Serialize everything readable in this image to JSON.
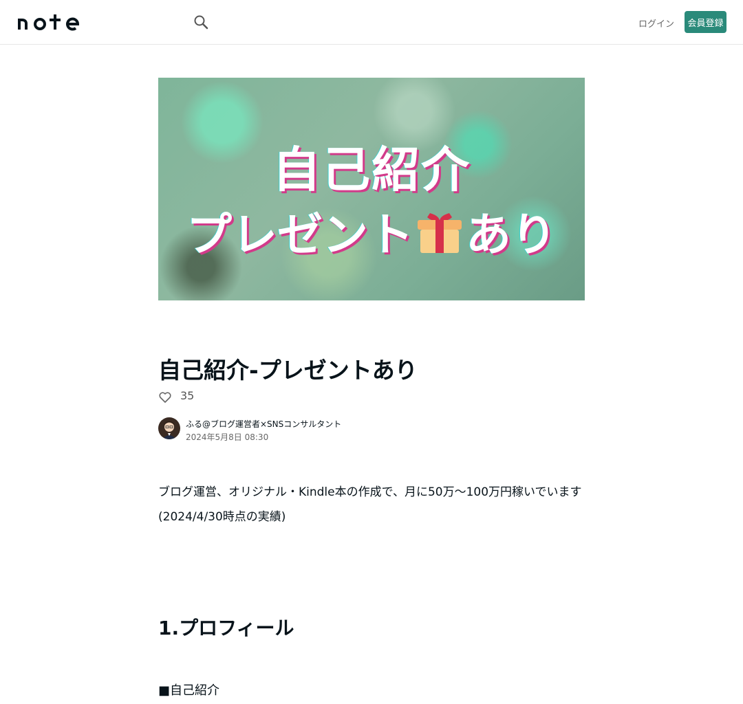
{
  "header": {
    "logo_text": "note",
    "login_label": "ログイン",
    "signup_label": "会員登録"
  },
  "hero": {
    "line1": "自己紹介",
    "line2_before": "プレゼント",
    "line2_after": "あり",
    "icon": "gift-icon"
  },
  "article": {
    "title": "自己紹介-プレゼントあり",
    "like_count": "35",
    "author": "ふる@ブログ運営者×SNSコンサルタント",
    "date": "2024年5月8日 08:30",
    "paragraph1": "ブログ運営、オリジナル・Kindle本の作成で、月に50万〜100万円稼いでいます",
    "paragraph2": "(2024/4/30時点の実績)",
    "heading1": "1.プロフィール",
    "paragraph3": "■自己紹介"
  },
  "colors": {
    "accent": "#2a8a7a",
    "text": "#08131a"
  }
}
